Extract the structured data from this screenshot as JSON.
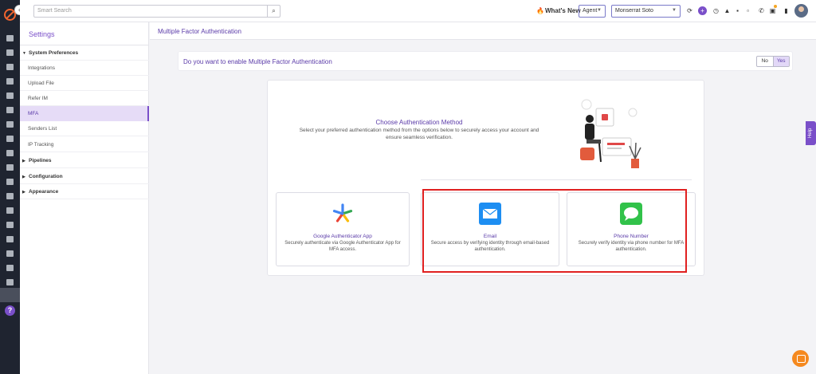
{
  "topbar": {
    "search_placeholder": "Smart Search",
    "whats_new": "What's New",
    "agent_select": "Agent",
    "user_select": "Monserrat Soto"
  },
  "sidebar": {
    "title": "Settings",
    "items": [
      {
        "label": "System Preferences",
        "type": "group",
        "expanded": true
      },
      {
        "label": "Integrations",
        "type": "item"
      },
      {
        "label": "Upload File",
        "type": "item"
      },
      {
        "label": "Refer IM",
        "type": "item"
      },
      {
        "label": "MFA",
        "type": "item",
        "active": true
      },
      {
        "label": "Senders List",
        "type": "item"
      },
      {
        "label": "IP Tracking",
        "type": "item"
      },
      {
        "label": "Pipelines",
        "type": "group"
      },
      {
        "label": "Configuration",
        "type": "group"
      },
      {
        "label": "Appearance",
        "type": "group"
      }
    ]
  },
  "main": {
    "header": "Multiple Factor Authentication",
    "question": "Do you want to enable Multiple Factor Authentication",
    "toggle": {
      "no": "No",
      "yes": "Yes",
      "selected": "Yes"
    },
    "choose_title": "Choose Authentication Method",
    "choose_subtitle": "Select your preferred authentication method from the options below to securely access your account and ensure seamless verification.",
    "options": [
      {
        "name": "Google Authenticator App",
        "desc": "Securely authenticate via Google Authenticator App for MFA access.",
        "icon": "google-authenticator-icon"
      },
      {
        "name": "Email",
        "desc": "Secure access by verifying identity through email-based authentication.",
        "icon": "email-icon"
      },
      {
        "name": "Phone Number",
        "desc": "Securely verify identity via phone number for MFA authentication.",
        "icon": "message-icon"
      }
    ]
  },
  "help_tab": "Help",
  "colors": {
    "accent": "#7a4fc9",
    "highlight": "#e02020",
    "orange": "#f5891f"
  }
}
